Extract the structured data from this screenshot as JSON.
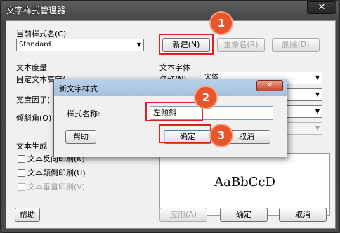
{
  "main": {
    "title": "文字样式管理器",
    "close_symbol": "✕",
    "current_style_label": "当前样式名(C)",
    "current_style_value": "Standard",
    "new_button": "新建(N)",
    "rename_button": "重命名(R)",
    "delete_button": "删除(D)",
    "text_metrics_label": "文本度量",
    "fixed_height_label": "固定文本高度(",
    "width_factor_label": "宽度因子(",
    "oblique_angle_label": "倾斜角(O)",
    "text_font_label": "文本字体",
    "font_name_label": "名称(N):",
    "font_name_value": "宋体",
    "text_gen_label": "文本生成",
    "backwards_check": "文本反向印刷(K)",
    "upside_check": "文本颠倒印刷(U)",
    "vertical_check": "文本垂直印刷(V)",
    "preview_text": "AaBbCcD",
    "help_button": "帮助",
    "apply_button": "应用(A)",
    "ok_button": "确定",
    "cancel_button": "取消"
  },
  "dialog": {
    "title": "新文字样式",
    "close_symbol": "✕",
    "style_name_label": "样式名称:",
    "style_name_value": "左倾斜",
    "help_button": "帮助",
    "ok_button": "确定",
    "cancel_button": "取消"
  },
  "annotations": {
    "badge1": "1",
    "badge2": "2",
    "badge3": "3",
    "color": "#e8552b"
  }
}
